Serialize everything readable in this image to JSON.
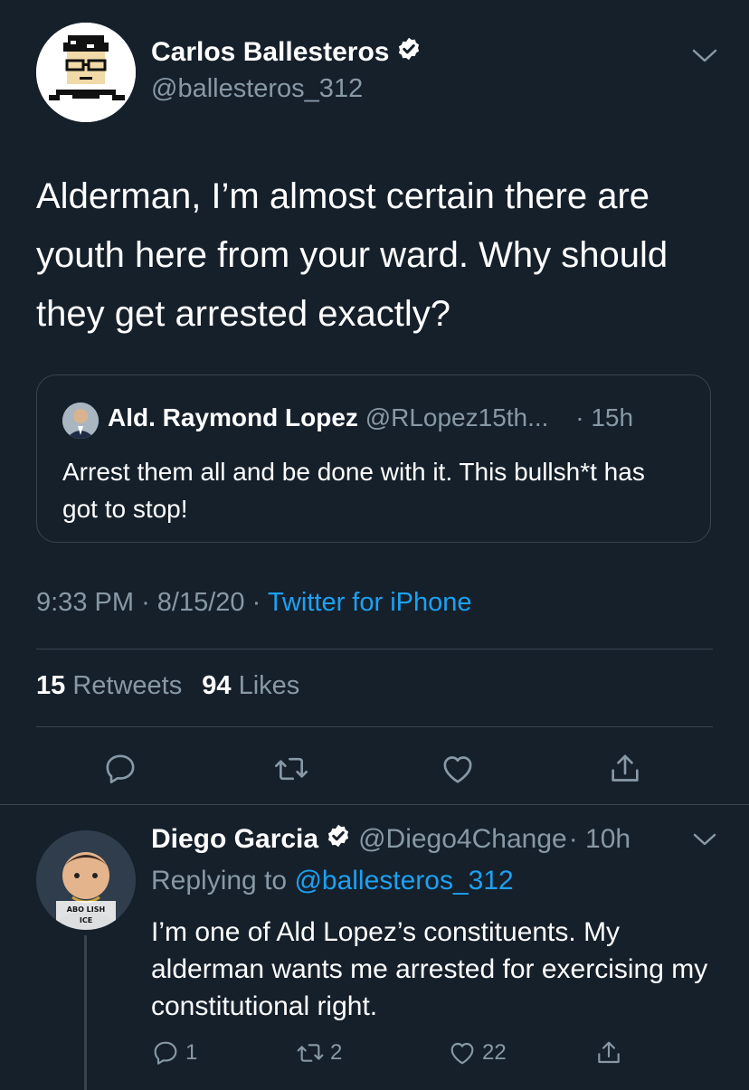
{
  "main_tweet": {
    "author_name": "Carlos Ballesteros",
    "handle": "@ballesteros_312",
    "text": "Alderman, I’m almost certain there are youth here from your ward. Why should they get arrested exactly?",
    "quoted": {
      "author_name": "Ald. Raymond Lopez",
      "handle": "@RLopez15th...",
      "age": "· 15h",
      "text": "Arrest them all and be done with it. This bullsh*t has got to stop!"
    },
    "time": "9:33 PM",
    "separator": "·",
    "date": "8/15/20",
    "source": "Twitter for iPhone",
    "retweets_count": "15",
    "retweets_label": "Retweets",
    "likes_count": "94",
    "likes_label": "Likes"
  },
  "reply": {
    "author_name": "Diego Garcia",
    "handle": "@Diego4Change",
    "age": "· 10h",
    "replying_prefix": "Replying to",
    "replying_to": "@ballesteros_312",
    "text": "I’m one of Ald Lopez’s constituents. My alderman wants me arrested for exercising my constitutional right.",
    "reply_count": "1",
    "retweet_count": "2",
    "like_count": "22",
    "avatar_sign_text": [
      "ABO LISH",
      "ICE"
    ]
  },
  "colors": {
    "background": "#15202b",
    "text": "#ffffff",
    "muted": "#8899a6",
    "link": "#1da1f2",
    "divider": "#38444d"
  },
  "icons": [
    "verified-badge-icon",
    "chevron-down-icon",
    "reply-icon",
    "retweet-icon",
    "like-icon",
    "share-icon"
  ]
}
